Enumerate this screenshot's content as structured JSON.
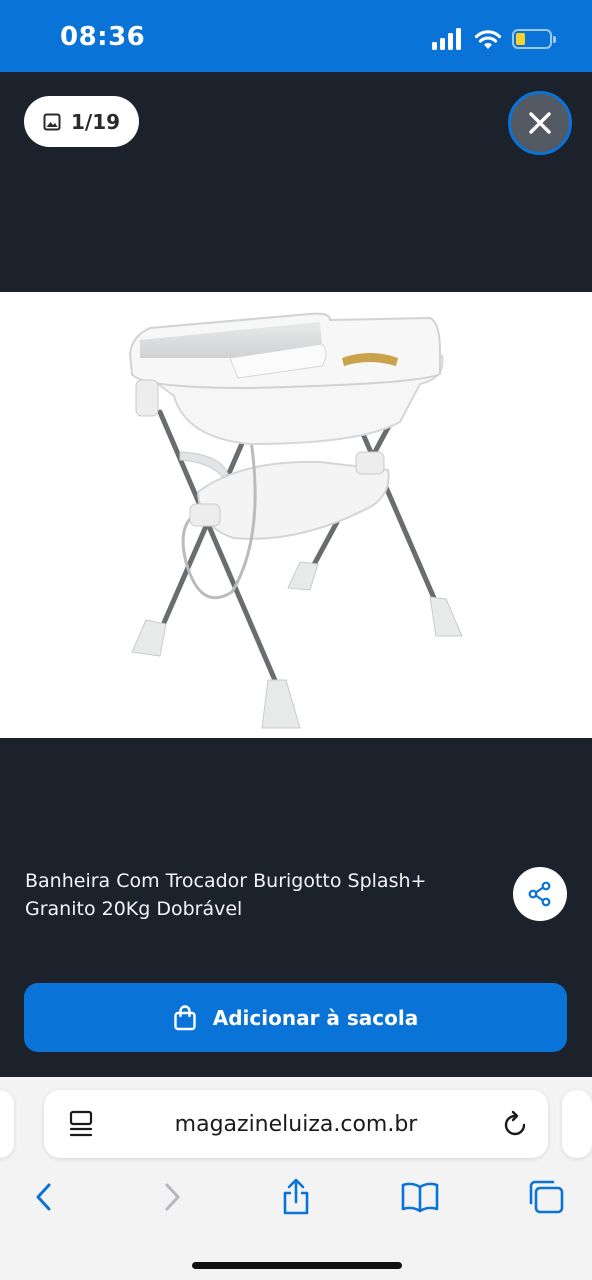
{
  "status_bar": {
    "time": "08:36"
  },
  "gallery": {
    "counter": "1/19",
    "product_title": "Banheira Com Trocador Burigotto Splash+ Granito 20Kg Dobrável",
    "add_to_bag_label": "Adicionar à sacola"
  },
  "browser": {
    "url": "magazineluiza.com.br"
  },
  "colors": {
    "brand_blue": "#0a73d8",
    "background": "#1c222c",
    "battery": "#f7d22e"
  }
}
